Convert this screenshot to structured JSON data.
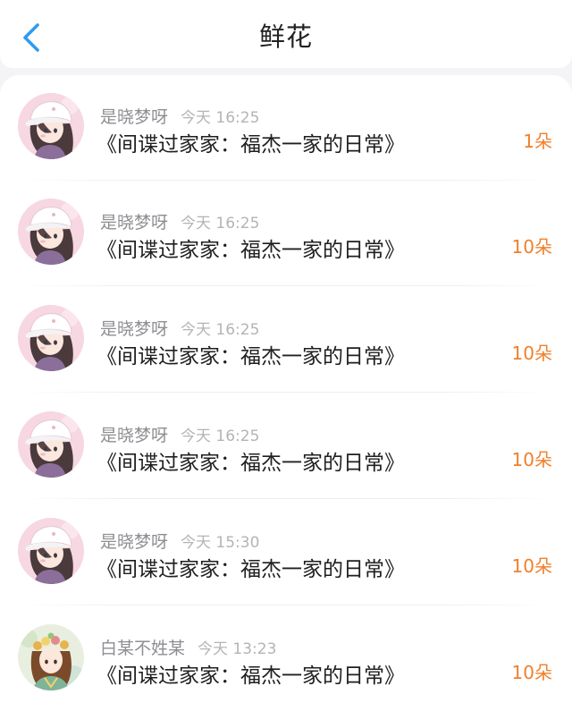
{
  "header": {
    "title": "鲜花",
    "back_icon": "chevron-left-icon",
    "accent_color": "#2f9bf0"
  },
  "colors": {
    "flower_count": "#f07f2a",
    "username": "#8e8e93",
    "timestamp": "#b4b4b8"
  },
  "records": [
    {
      "user": "是晓梦呀",
      "time": "今天 16:25",
      "book": "《间谍过家家：福杰一家的日常》",
      "count": "1朵",
      "avatar": "avatar-pink-cap-girl"
    },
    {
      "user": "是晓梦呀",
      "time": "今天 16:25",
      "book": "《间谍过家家：福杰一家的日常》",
      "count": "10朵",
      "avatar": "avatar-pink-cap-girl"
    },
    {
      "user": "是晓梦呀",
      "time": "今天 16:25",
      "book": "《间谍过家家：福杰一家的日常》",
      "count": "10朵",
      "avatar": "avatar-pink-cap-girl"
    },
    {
      "user": "是晓梦呀",
      "time": "今天 16:25",
      "book": "《间谍过家家：福杰一家的日常》",
      "count": "10朵",
      "avatar": "avatar-pink-cap-girl"
    },
    {
      "user": "是晓梦呀",
      "time": "今天 15:30",
      "book": "《间谍过家家：福杰一家的日常》",
      "count": "10朵",
      "avatar": "avatar-pink-cap-girl"
    },
    {
      "user": "白某不姓某",
      "time": "今天 13:23",
      "book": "《间谍过家家：福杰一家的日常》",
      "count": "10朵",
      "avatar": "avatar-flower-crown-girl"
    }
  ]
}
